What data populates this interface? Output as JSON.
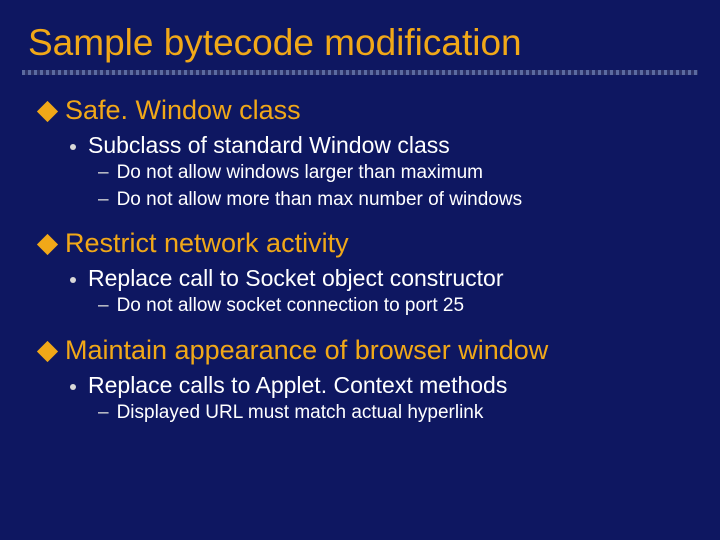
{
  "title": "Sample bytecode modification",
  "sections": [
    {
      "heading": "Safe. Window class",
      "bullets": [
        {
          "text": "Subclass of standard Window class",
          "sub": [
            "Do not allow windows larger than maximum",
            "Do not allow more than max number of windows"
          ]
        }
      ]
    },
    {
      "heading": "Restrict network activity",
      "bullets": [
        {
          "text": "Replace call to Socket object constructor",
          "sub": [
            "Do not allow socket connection to port 25"
          ]
        }
      ]
    },
    {
      "heading": "Maintain appearance of browser window",
      "bullets": [
        {
          "text": "Replace calls to Applet. Context methods",
          "sub": [
            "Displayed URL must match actual hyperlink"
          ]
        }
      ]
    }
  ]
}
